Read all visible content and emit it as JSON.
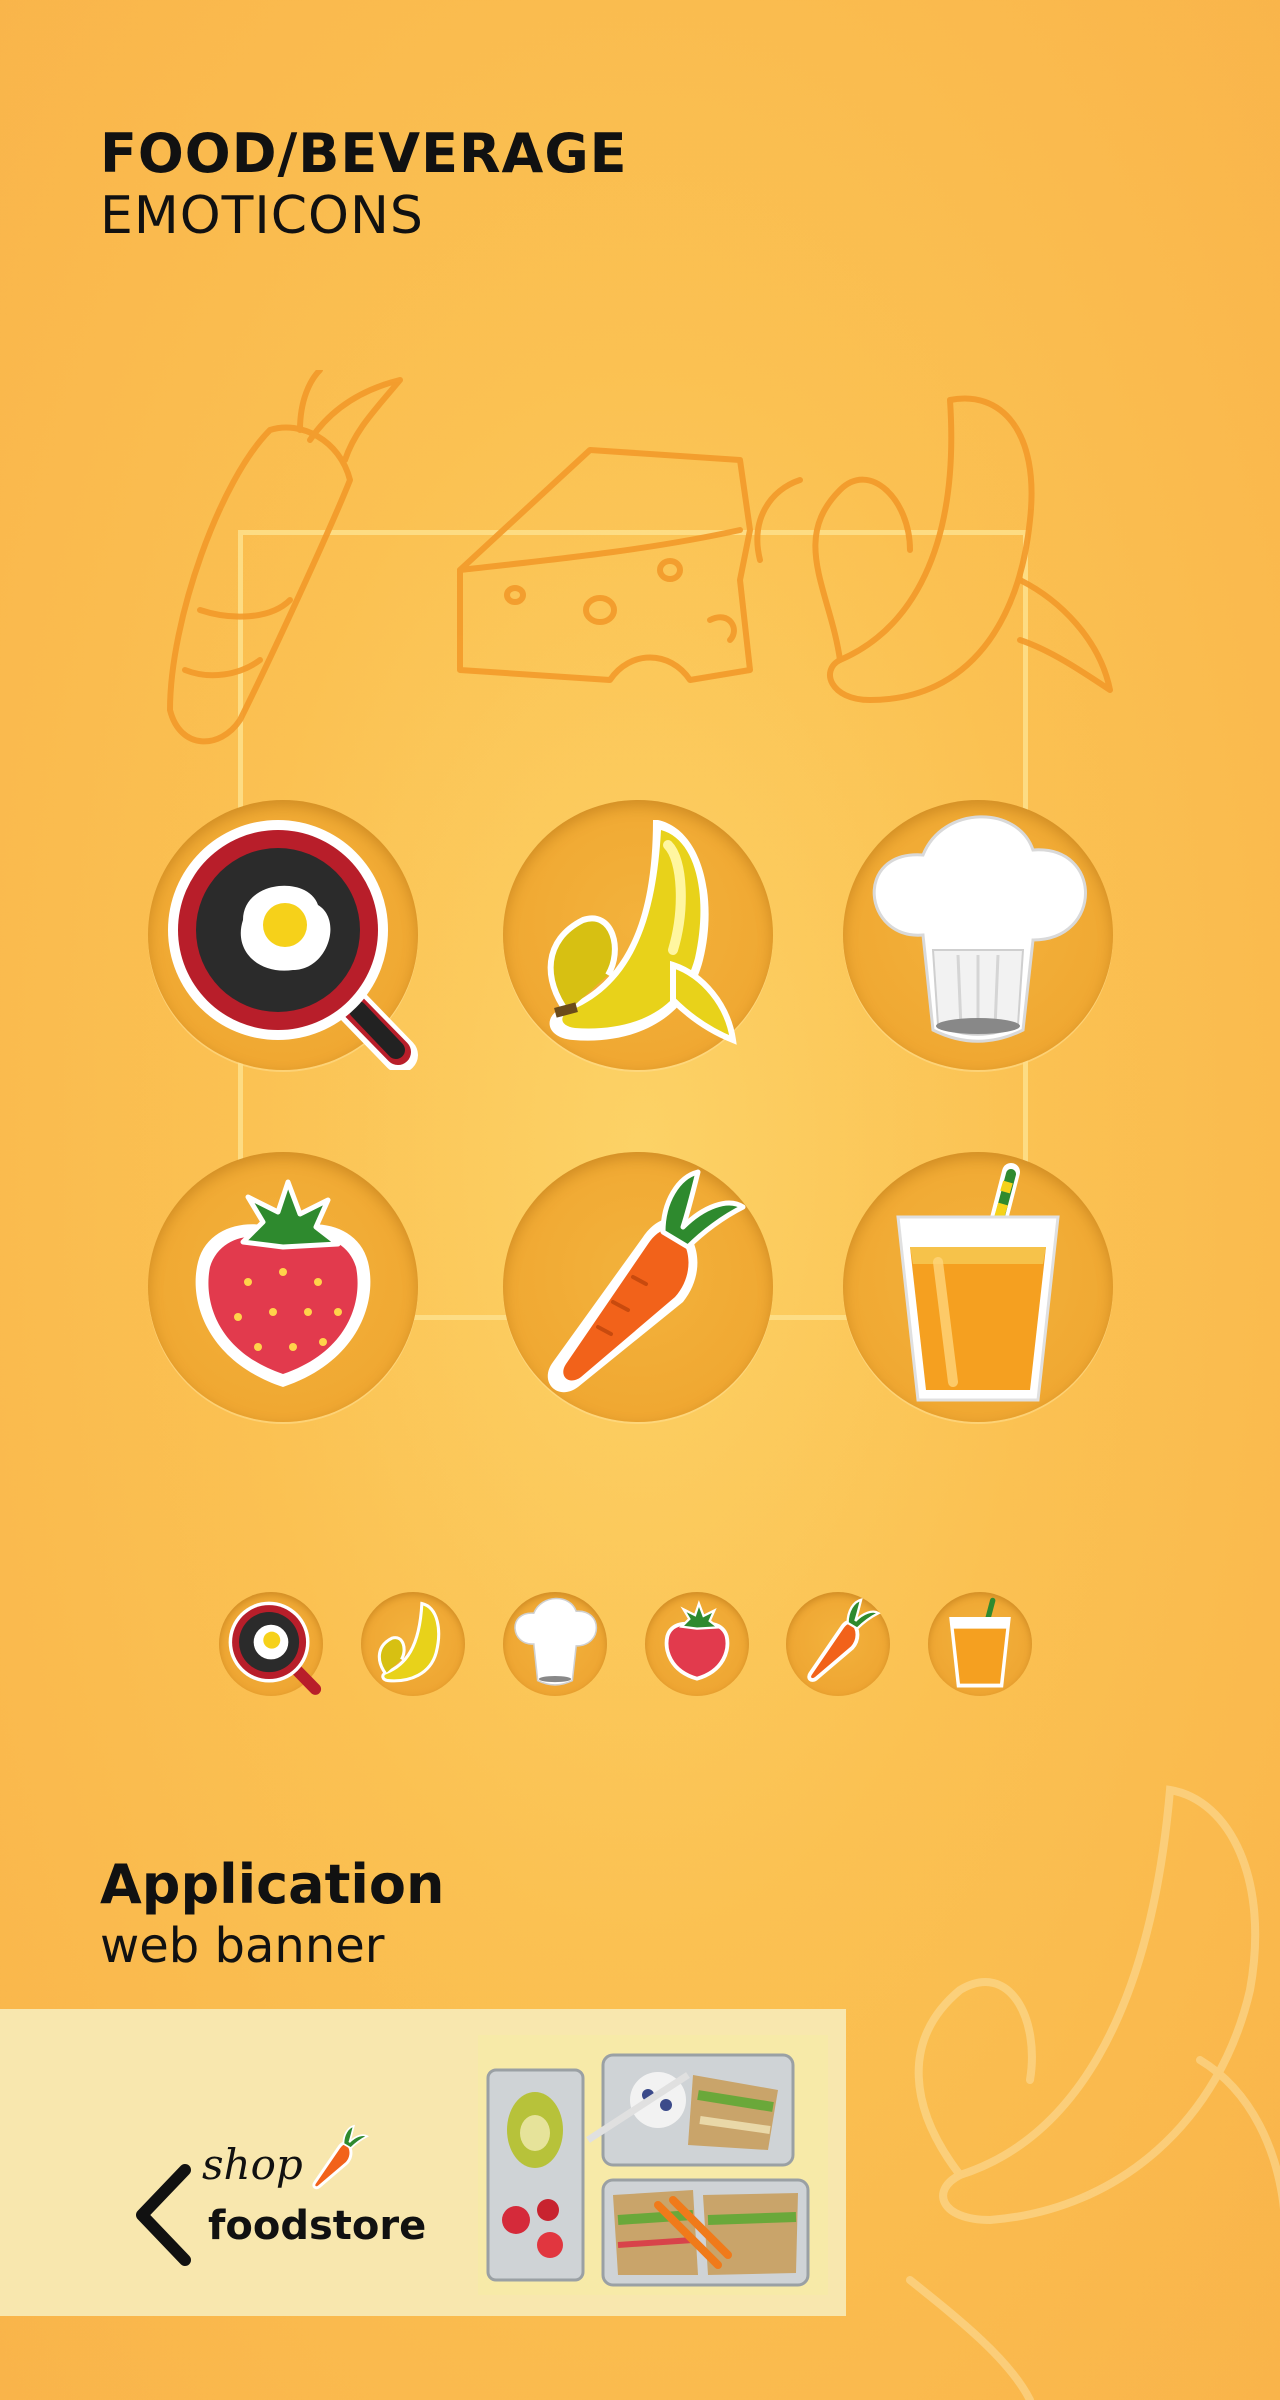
{
  "header": {
    "title": "FOOD/BEVERAGE",
    "subtitle": "EMOTICONS"
  },
  "icons": [
    {
      "name": "frying-pan-egg-icon"
    },
    {
      "name": "banana-icon"
    },
    {
      "name": "chef-hat-icon"
    },
    {
      "name": "strawberry-icon"
    },
    {
      "name": "carrot-icon"
    },
    {
      "name": "juice-glass-icon"
    }
  ],
  "application": {
    "title": "Application",
    "subtitle": "web banner"
  },
  "banner": {
    "shop_label": "shop",
    "store_label": "foodstore"
  },
  "colors": {
    "background": "#fbc152",
    "accent": "#f7931e",
    "banner_bg": "#f8e7ae"
  }
}
